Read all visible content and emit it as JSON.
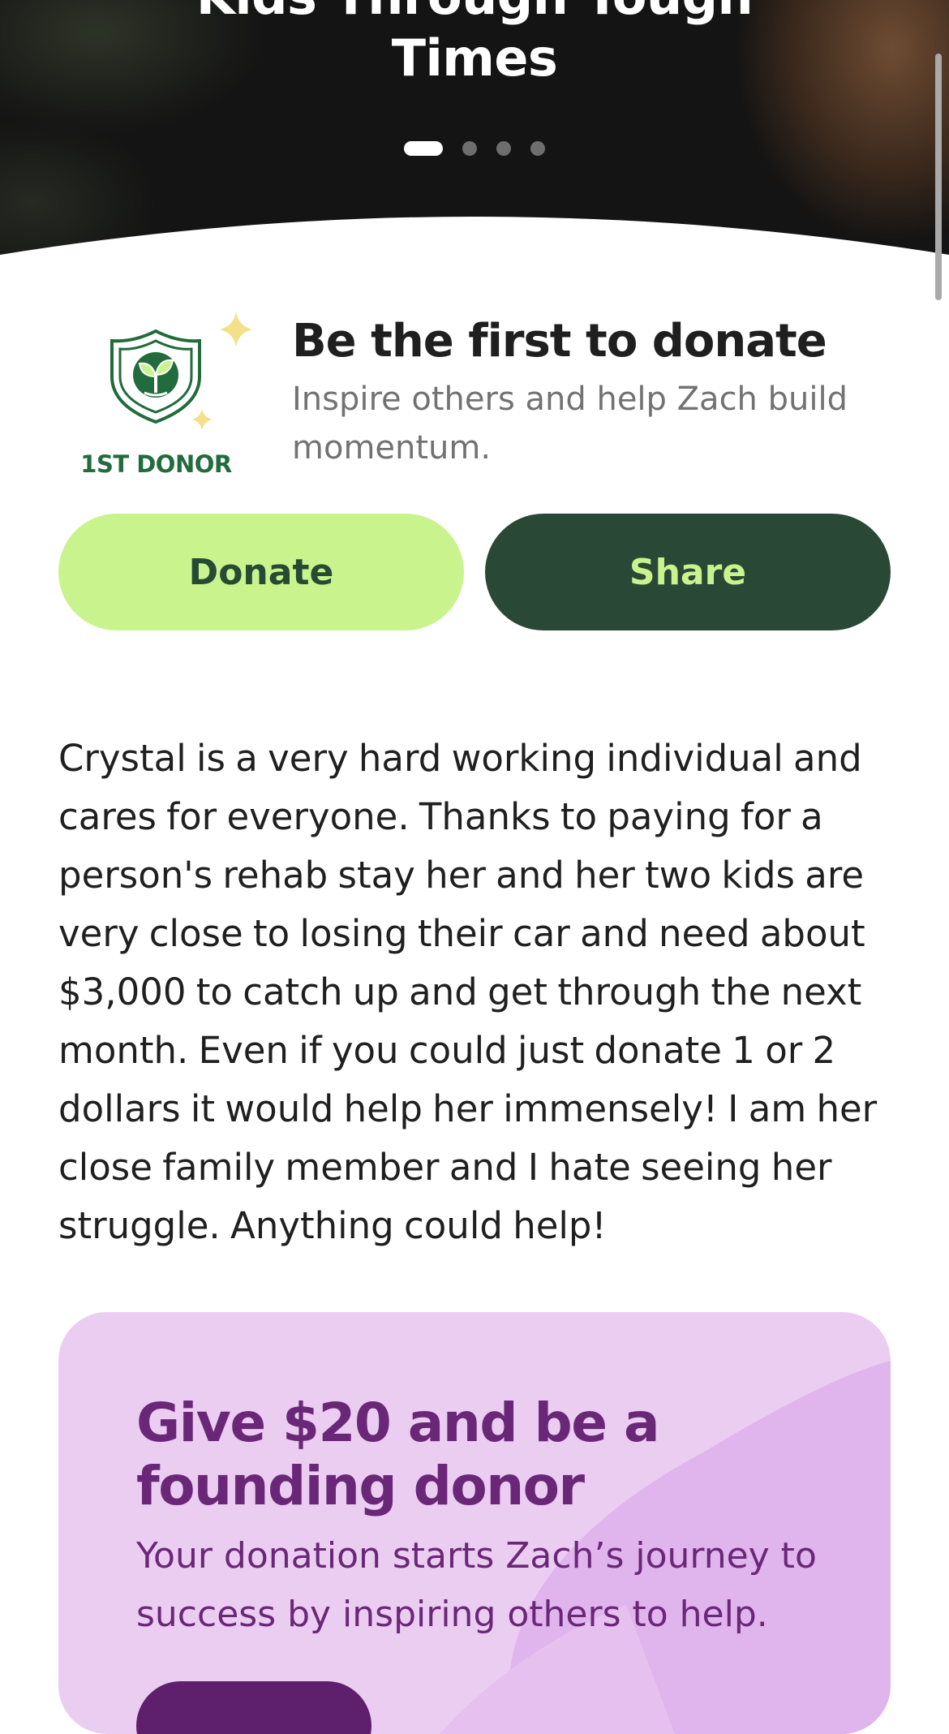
{
  "hero": {
    "title_line1": "Kids Through Tough",
    "title_line2": "Times",
    "carousel": {
      "slide_count": 4,
      "active_index": 0
    }
  },
  "first_donor": {
    "badge_label": "1ST DONOR",
    "title": "Be the first to donate",
    "subtitle": "Inspire others and help Zach build momentum."
  },
  "actions": {
    "donate_label": "Donate",
    "share_label": "Share"
  },
  "story": {
    "text": "Crystal is a very hard working individual and cares for everyone. Thanks to paying for a person's rehab stay her and her two kids are very close to losing their car and need about $3,000 to catch up and get through the next month. Even if you could just donate 1 or 2 dollars it would help her immensely! I am her close family member and I hate seeing her struggle. Anything could help!"
  },
  "founding_card": {
    "title": "Give $20 and be a founding donor",
    "text": "Your donation starts Zach’s journey to success by inspiring others to help."
  },
  "colors": {
    "donate_bg": "#c9f38d",
    "share_bg": "#2a4836",
    "badge_green": "#216b3c",
    "card_bg": "#ebcdf2",
    "card_text": "#6a2777",
    "sparkle": "#f3e089"
  }
}
